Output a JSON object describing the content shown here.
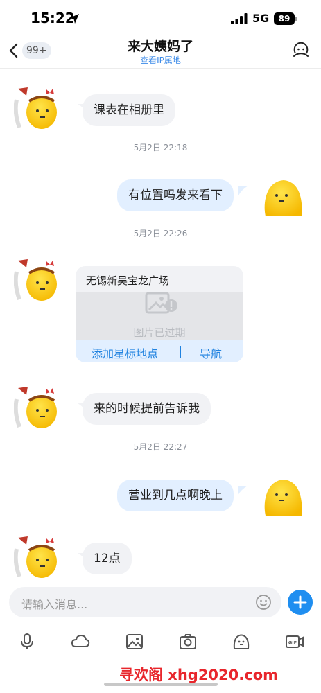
{
  "status_bar": {
    "time": "15:22",
    "network": "5G",
    "battery": "89"
  },
  "nav": {
    "back_badge": "99+",
    "title": "来大姨妈了",
    "subtitle": "查看IP属地"
  },
  "messages": {
    "m1": "课表在相册里",
    "t1": "5月2日 22:18",
    "m2": "有位置吗发来看下",
    "t2": "5月2日 22:26",
    "location": {
      "name": "无锡新吴宝龙广场",
      "expired": "图片已过期",
      "add_star": "添加星标地点",
      "navigate": "导航"
    },
    "m3": "来的时候提前告诉我",
    "t3": "5月2日 22:27",
    "m4": "营业到几点啊晚上",
    "m5": "12点"
  },
  "input": {
    "placeholder": "请输入消息..."
  },
  "toolbar": [
    "mic-icon",
    "cloud-icon",
    "image-icon",
    "camera-icon",
    "emoji-icon",
    "gif-icon"
  ],
  "watermark": "寻欢阁 xhg2020.com",
  "colors": {
    "accent": "#1f8ef0",
    "outgoing_bubble": "#e2efff",
    "incoming_bubble": "#f1f2f5",
    "watermark": "#e8262c"
  }
}
